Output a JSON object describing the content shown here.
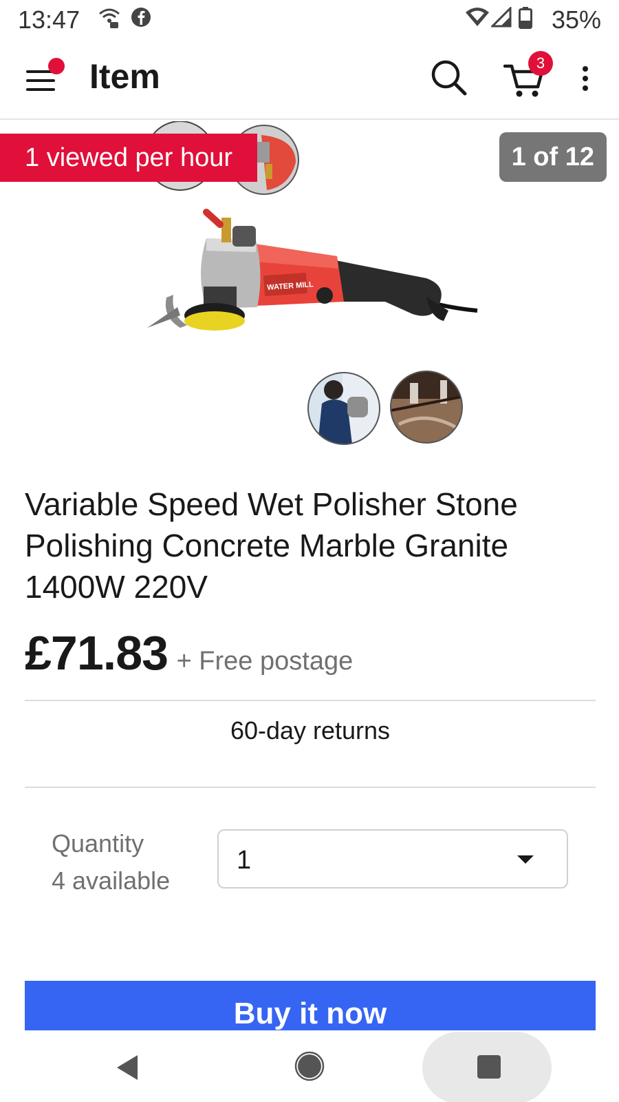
{
  "status_bar": {
    "time": "13:47",
    "battery": "35%",
    "icons": [
      "wifi-calling-icon",
      "facebook-icon",
      "wifi-icon",
      "signal-icon",
      "battery-icon"
    ]
  },
  "app_bar": {
    "title": "Item",
    "cart_count": "3",
    "icons": [
      "menu-icon",
      "search-icon",
      "cart-icon",
      "more-vert-icon"
    ]
  },
  "hero": {
    "viewed_badge": "1 viewed per hour",
    "image_counter": "1 of 12",
    "product_label": "WATER MILL"
  },
  "item": {
    "title": "Variable Speed Wet Polisher Stone Polishing Concrete Marble Granite 1400W 220V",
    "price": "£71.83",
    "postage": "+ Free postage",
    "returns": "60-day returns"
  },
  "quantity": {
    "label": "Quantity",
    "available": "4 available",
    "selected": "1"
  },
  "buy_button": {
    "label": "Buy it now"
  },
  "colors": {
    "accent_red": "#e0103a",
    "buy_blue": "#3665f3",
    "badge_gray": "#767676"
  },
  "nav_bar": {
    "icons": [
      "back-icon",
      "home-icon",
      "recents-icon"
    ]
  }
}
